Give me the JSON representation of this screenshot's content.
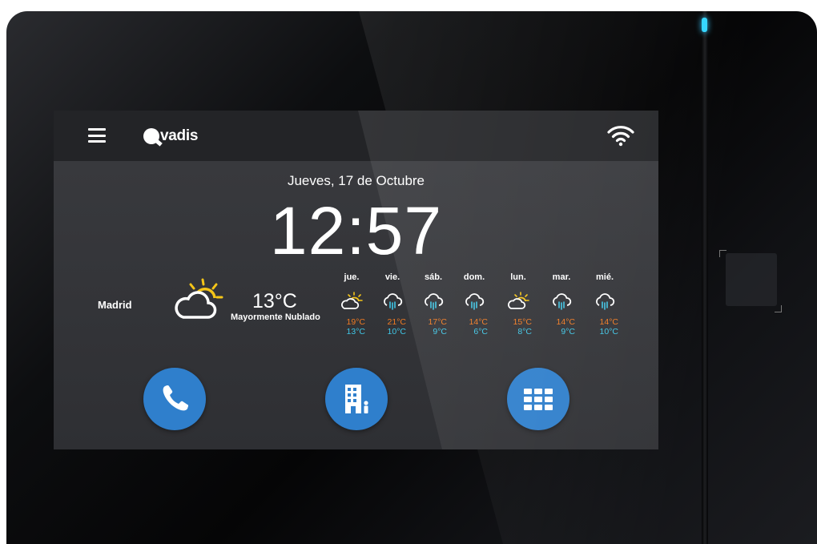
{
  "header": {
    "logo_text": "vadis",
    "menu_icon": "menu-icon",
    "wifi_icon": "wifi-icon"
  },
  "date_label": "Jueves, 17 de Octubre",
  "time": "12:57",
  "weather": {
    "city": "Madrid",
    "current_temp": "13°C",
    "condition": "Mayormente Nublado",
    "icon": "partly-cloudy-icon"
  },
  "forecast": [
    {
      "day": "jue.",
      "icon": "partly-cloudy-icon",
      "high": "19°C",
      "low": "13°C"
    },
    {
      "day": "vie.",
      "icon": "rain-icon",
      "high": "21°C",
      "low": "10°C"
    },
    {
      "day": "sáb.",
      "icon": "rain-icon",
      "high": "17°C",
      "low": "9°C"
    },
    {
      "day": "dom.",
      "icon": "rain-icon",
      "high": "14°C",
      "low": "6°C"
    },
    {
      "day": "lun.",
      "icon": "partly-cloudy-icon",
      "high": "15°C",
      "low": "8°C"
    },
    {
      "day": "mar.",
      "icon": "rain-icon",
      "high": "14°C",
      "low": "9°C"
    },
    {
      "day": "mié.",
      "icon": "rain-icon",
      "high": "14°C",
      "low": "10°C"
    }
  ],
  "actions": [
    {
      "name": "call-button",
      "icon": "phone-icon"
    },
    {
      "name": "building-button",
      "icon": "building-icon"
    },
    {
      "name": "keypad-button",
      "icon": "keypad-icon"
    }
  ],
  "colors": {
    "accent_blue": "#2f7fcc",
    "temp_high": "#f07a22",
    "temp_low": "#3fc6e6",
    "led": "#34d6ff",
    "sun": "#f5c518"
  }
}
